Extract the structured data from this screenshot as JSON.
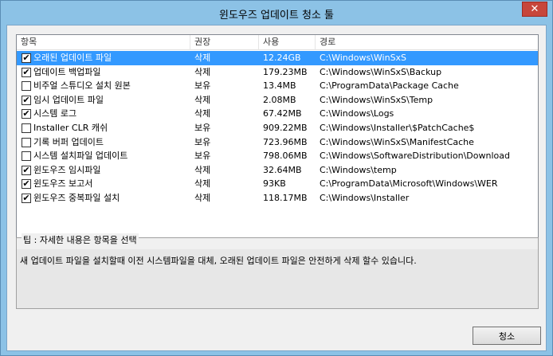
{
  "window": {
    "title": "윈도우즈 업데이트 청소 툴",
    "close_glyph": "✕"
  },
  "columns": {
    "item": "항목",
    "perm": "권장",
    "size": "사용",
    "path": "경로"
  },
  "rows": [
    {
      "checked": "✔",
      "name": "오래된 업데이트 파일",
      "perm": "삭제",
      "size": "12.24GB",
      "path": "C:\\Windows\\WinSxS"
    },
    {
      "checked": "✔",
      "name": "업데이트 백업파일",
      "perm": "삭제",
      "size": "179.23MB",
      "path": "C:\\Windows\\WinSxS\\Backup"
    },
    {
      "checked": "",
      "name": "비주얼 스튜디오 설치 원본",
      "perm": "보유",
      "size": "13.4MB",
      "path": "C:\\ProgramData\\Package Cache"
    },
    {
      "checked": "✔",
      "name": "임시 업데이트 파일",
      "perm": "삭제",
      "size": "2.08MB",
      "path": "C:\\Windows\\WinSxS\\Temp"
    },
    {
      "checked": "✔",
      "name": "시스템 로그",
      "perm": "삭제",
      "size": "67.42MB",
      "path": "C:\\Windows\\Logs"
    },
    {
      "checked": "",
      "name": "Installer CLR 캐쉬",
      "perm": "보유",
      "size": "909.22MB",
      "path": "C:\\Windows\\Installer\\$PatchCache$"
    },
    {
      "checked": "",
      "name": "기록 버퍼 업데이트",
      "perm": "보유",
      "size": "723.96MB",
      "path": "C:\\Windows\\WinSxS\\ManifestCache"
    },
    {
      "checked": "",
      "name": "시스템 설치파일 업데이트",
      "perm": "보유",
      "size": "798.06MB",
      "path": "C:\\Windows\\SoftwareDistribution\\Download"
    },
    {
      "checked": "✔",
      "name": "윈도우즈 임시파일",
      "perm": "삭제",
      "size": "32.64MB",
      "path": "C:\\Windows\\temp"
    },
    {
      "checked": "✔",
      "name": "윈도우즈 보고서",
      "perm": "삭제",
      "size": "93KB",
      "path": "C:\\ProgramData\\Microsoft\\Windows\\WER"
    },
    {
      "checked": "✔",
      "name": "윈도우즈 중복파일 설치",
      "perm": "삭제",
      "size": "118.17MB",
      "path": "C:\\Windows\\Installer"
    }
  ],
  "tip": {
    "label": "팁 : 자세한 내용은 항목을 선택",
    "text": "새 업데이트 파일을 설치할때 이전 시스템파일을 대체, 오래된 업데이트 파일은 안전하게 삭제 할수 있습니다."
  },
  "buttons": {
    "clean": "청소"
  },
  "colors": {
    "selection": "#3399ff",
    "frame": "#8cc2e6"
  }
}
